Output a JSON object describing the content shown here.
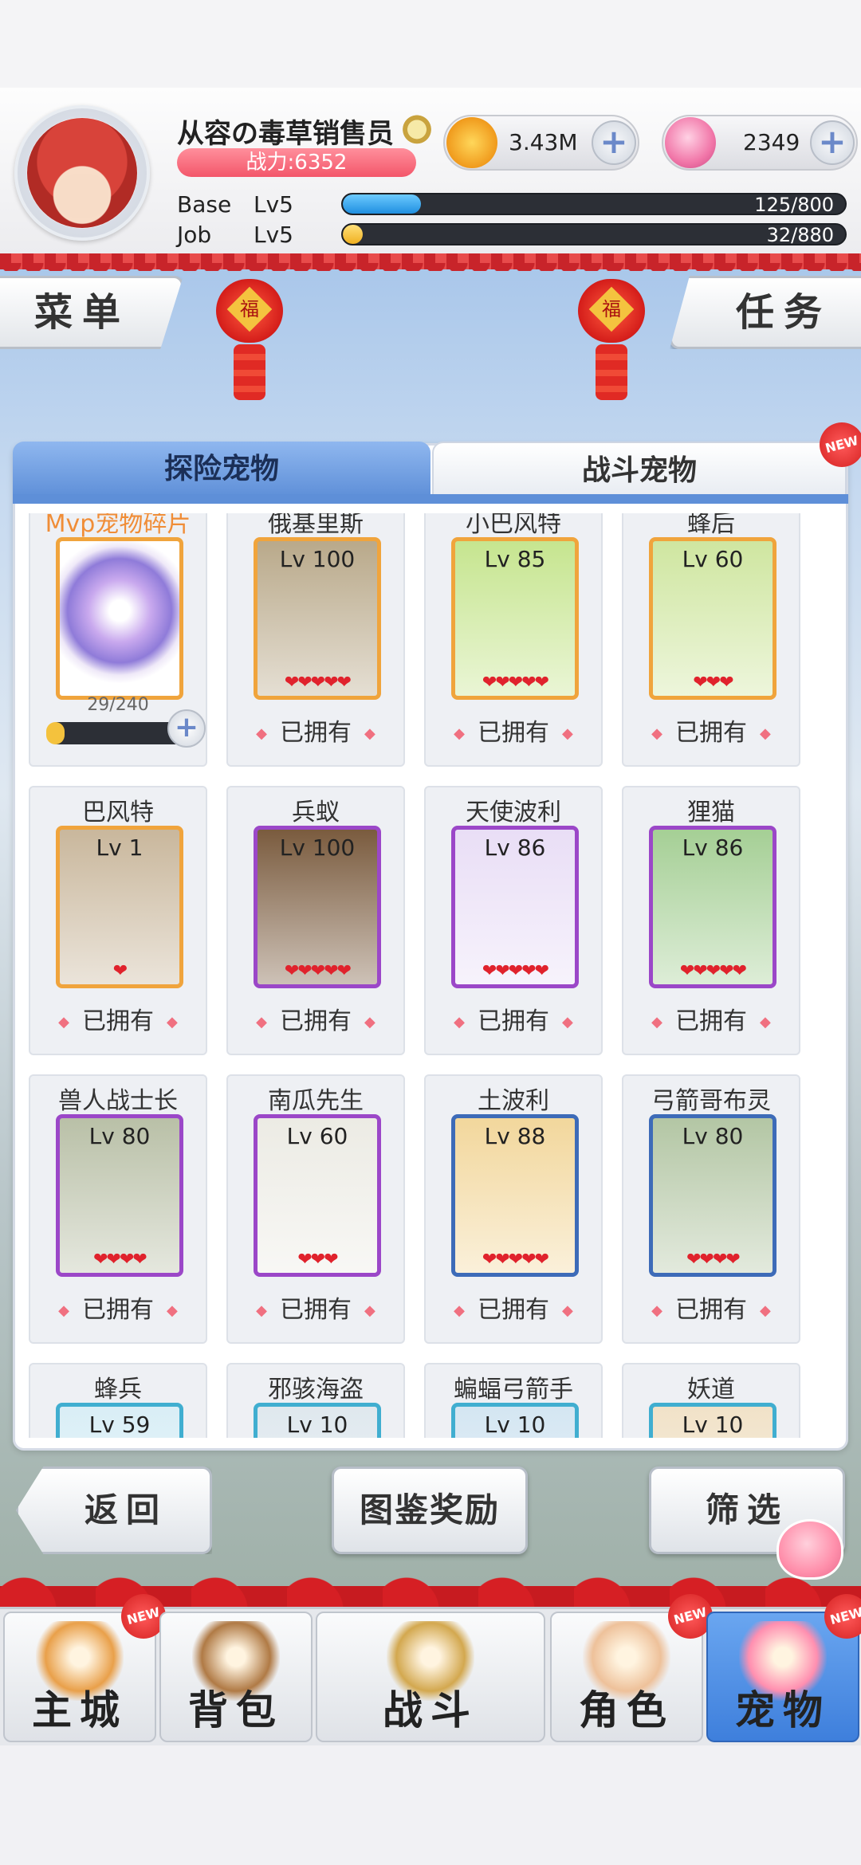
{
  "header": {
    "player_name": "从容の毒草销售员",
    "power": "战力:6352",
    "base_label": "Base",
    "base_level": "Lv5",
    "base_exp": "125/800",
    "base_exp_fraction": 0.156,
    "job_label": "Job",
    "job_level": "Lv5",
    "job_exp": "32/880",
    "job_exp_fraction": 0.036,
    "gold": "3.43M",
    "gems": "2349"
  },
  "side_buttons": {
    "menu": "菜单",
    "task": "任务"
  },
  "lanterns": {
    "char": "福"
  },
  "tabs": [
    {
      "label": "探险宠物",
      "active": true
    },
    {
      "label": "战斗宠物",
      "active": false,
      "badge": "NEW"
    }
  ],
  "mvp_card": {
    "name": "Mvp宠物碎片",
    "progress": "29/240",
    "fraction": 0.12
  },
  "pets": [
    {
      "name": "俄基里斯",
      "level": "Lv 100",
      "stars": 5,
      "status": "已拥有",
      "frame": "orange",
      "art": "#b9a98a"
    },
    {
      "name": "小巴风特",
      "level": "Lv 85",
      "stars": 5,
      "status": "已拥有",
      "frame": "orange",
      "art": "#c6e58f"
    },
    {
      "name": "蜂后",
      "level": "Lv 60",
      "stars": 3,
      "status": "已拥有",
      "frame": "orange",
      "art": "#cfe6a0"
    },
    {
      "name": "巴风特",
      "level": "Lv 1",
      "stars": 1,
      "status": "已拥有",
      "frame": "orange",
      "art": "#c9b79c"
    },
    {
      "name": "兵蚁",
      "level": "Lv 100",
      "stars": 5,
      "status": "已拥有",
      "frame": "purple",
      "art": "#7a5b3e"
    },
    {
      "name": "天使波利",
      "level": "Lv 86",
      "stars": 5,
      "status": "已拥有",
      "frame": "purple",
      "art": "#e9def6"
    },
    {
      "name": "狸猫",
      "level": "Lv 86",
      "stars": 5,
      "status": "已拥有",
      "frame": "purple",
      "art": "#a5cf95"
    },
    {
      "name": "兽人战士长",
      "level": "Lv 80",
      "stars": 4,
      "status": "已拥有",
      "frame": "purple",
      "art": "#b9c0a7"
    },
    {
      "name": "南瓜先生",
      "level": "Lv 60",
      "stars": 3,
      "status": "已拥有",
      "frame": "purple",
      "art": "#ecebe4"
    },
    {
      "name": "土波利",
      "level": "Lv 88",
      "stars": 5,
      "status": "已拥有",
      "frame": "blue",
      "art": "#f2d79c"
    },
    {
      "name": "弓箭哥布灵",
      "level": "Lv 80",
      "stars": 4,
      "status": "已拥有",
      "frame": "blue",
      "art": "#b3c6a4"
    },
    {
      "name": "蜂兵",
      "level": "Lv 59",
      "stars": 0,
      "status": "",
      "frame": "teal",
      "art": "#d9eef6"
    },
    {
      "name": "邪骇海盗",
      "level": "Lv 10",
      "stars": 0,
      "status": "",
      "frame": "teal",
      "art": "#dfe8ee"
    },
    {
      "name": "蝙蝠弓箭手",
      "level": "Lv 10",
      "stars": 0,
      "status": "",
      "frame": "teal",
      "art": "#d4e6f2"
    },
    {
      "name": "妖道",
      "level": "Lv 10",
      "stars": 0,
      "status": "",
      "frame": "teal",
      "art": "#f1e2c8"
    }
  ],
  "actions": {
    "back": "返回",
    "reward": "图鉴奖励",
    "filter": "筛选"
  },
  "nav": [
    {
      "label": "主城",
      "badge": "NEW",
      "active": false,
      "icon": "castle-icon"
    },
    {
      "label": "背包",
      "badge": "",
      "active": false,
      "icon": "backpack-icon"
    },
    {
      "label": "战斗",
      "badge": "",
      "active": false,
      "icon": "crossed-swords-icon"
    },
    {
      "label": "角色",
      "badge": "NEW",
      "active": false,
      "icon": "character-icon"
    },
    {
      "label": "宠物",
      "badge": "NEW",
      "active": true,
      "icon": "pet-icon"
    }
  ],
  "new_badge": "NEW",
  "colors": {
    "accent_blue": "#5e8fd8",
    "festive_red": "#c8242a",
    "power_pink": "#f3566a"
  }
}
